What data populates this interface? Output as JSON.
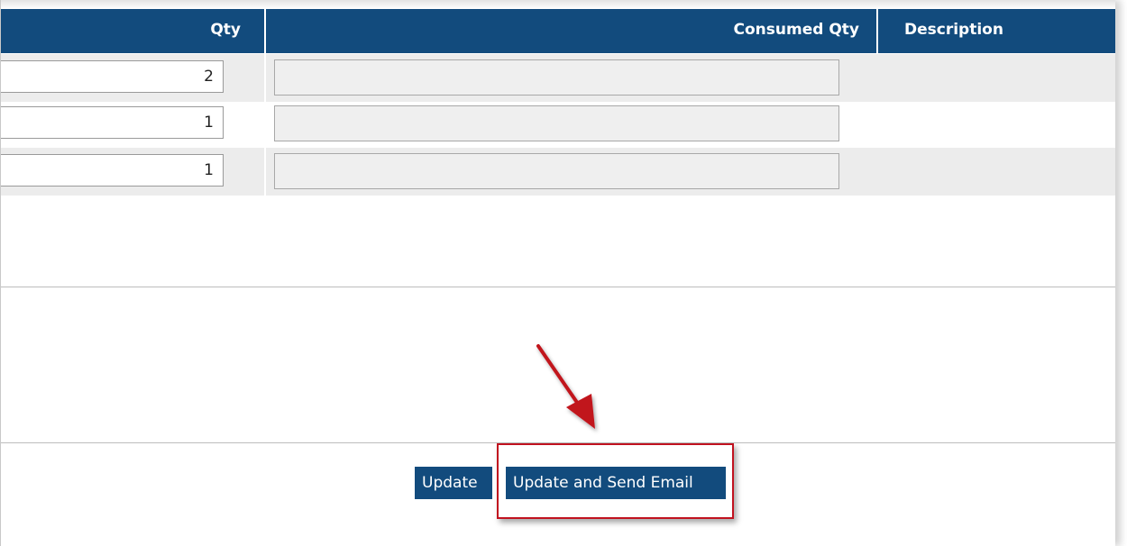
{
  "table": {
    "columns": {
      "qty": "Qty",
      "consumed_qty": "Consumed Qty",
      "description": "Description"
    },
    "rows": [
      {
        "qty": "2",
        "consumed_qty": "",
        "description": ""
      },
      {
        "qty": "1",
        "consumed_qty": "",
        "description": ""
      },
      {
        "qty": "1",
        "consumed_qty": "",
        "description": ""
      }
    ]
  },
  "actions": {
    "update_label": "Update",
    "update_send_email_label": "Update and Send Email"
  },
  "annotation": {
    "arrow_color": "#c1121f",
    "highlight_color": "#c1121f"
  },
  "colors": {
    "header_bg": "#124b7d",
    "button_bg": "#124b7d",
    "alt_row_bg": "#ececec"
  }
}
